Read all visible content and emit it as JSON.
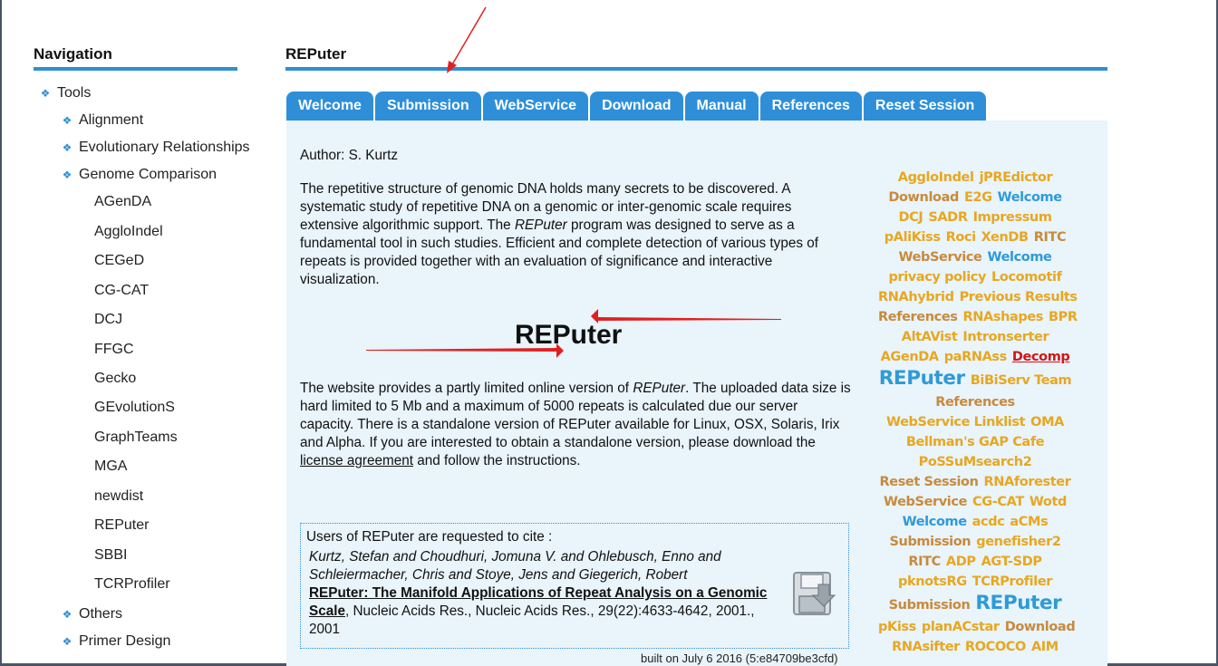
{
  "navigation": {
    "heading": "Navigation",
    "items": [
      {
        "label": "Tools",
        "level": 0,
        "expanded": true
      },
      {
        "label": "Alignment",
        "level": 1,
        "expanded": false
      },
      {
        "label": "Evolutionary Relationships",
        "level": 1,
        "expanded": false
      },
      {
        "label": "Genome Comparison",
        "level": 1,
        "expanded": true
      },
      {
        "label": "AGenDA",
        "level": 2
      },
      {
        "label": "AggloIndel",
        "level": 2
      },
      {
        "label": "CEGeD",
        "level": 2
      },
      {
        "label": "CG-CAT",
        "level": 2
      },
      {
        "label": "DCJ",
        "level": 2
      },
      {
        "label": "FFGC",
        "level": 2
      },
      {
        "label": "Gecko",
        "level": 2
      },
      {
        "label": "GEvolutionS",
        "level": 2
      },
      {
        "label": "GraphTeams",
        "level": 2
      },
      {
        "label": "MGA",
        "level": 2
      },
      {
        "label": "newdist",
        "level": 2
      },
      {
        "label": "REPuter",
        "level": 2
      },
      {
        "label": "SBBI",
        "level": 2
      },
      {
        "label": "TCRProfiler",
        "level": 2
      },
      {
        "label": "Others",
        "level": 1,
        "expanded": false
      },
      {
        "label": "Primer Design",
        "level": 1,
        "expanded": false
      }
    ]
  },
  "main": {
    "title": "REPuter",
    "tabs": [
      "Welcome",
      "Submission",
      "WebService",
      "Download",
      "Manual",
      "References",
      "Reset Session"
    ],
    "author": "Author: S. Kurtz",
    "desc1_a": "The repetitive structure of genomic DNA holds many secrets to be discovered. A systematic study of repetitive DNA on a genomic or inter-genomic scale requires extensive algorithmic support. The ",
    "desc1_em": "REPuter",
    "desc1_b": " program was designed to serve as a fundamental tool in such studies. Efficient and complete detection of various types of repeats is provided together with an evaluation of significance and interactive visualization.",
    "logo_text": "REPuter",
    "desc2_a": "The website provides a partly limited online version of ",
    "desc2_em": "REPuter",
    "desc2_b": ". The uploaded data size is hard limited to 5 Mb and a maximum of 5000 repeats is calculated due our server capacity. There is a standalone version of REPuter available for Linux, OSX, Solaris, Irix and Alpha. If you are interested to obtain a standalone version, please download the ",
    "desc2_link": "license agreement",
    "desc2_c": " and follow the instructions.",
    "cite": {
      "intro": "Users of REPuter are requested to cite :",
      "authors": "Kurtz, Stefan and Choudhuri, Jomuna V. and Ohlebusch, Enno and Schleiermacher, Chris and Stoye, Jens and Giegerich, Robert",
      "title": "REPuter: The Manifold Applications of Repeat Analysis on a Genomic Scale",
      "journal": ", Nucleic Acids Res., Nucleic Acids Res., 29(22):4633-4642, 2001., 2001"
    },
    "built": "built on July 6 2016 (5:e84709be3cfd)"
  },
  "tag_cloud": [
    [
      {
        "t": "AggloIndel",
        "c": "yellow",
        "s": 15
      },
      {
        "t": "jPREdictor",
        "c": "yellow",
        "s": 15
      }
    ],
    [
      {
        "t": "Download",
        "c": "brown",
        "s": 15
      },
      {
        "t": "E2G",
        "c": "yellow",
        "s": 15
      },
      {
        "t": "Welcome",
        "c": "blue",
        "s": 15
      }
    ],
    [
      {
        "t": "DCJ",
        "c": "yellow",
        "s": 15
      },
      {
        "t": "SADR",
        "c": "yellow",
        "s": 15
      },
      {
        "t": "Impressum",
        "c": "yellow",
        "s": 15
      }
    ],
    [
      {
        "t": "pAliKiss",
        "c": "yellow",
        "s": 15
      },
      {
        "t": "Roci",
        "c": "yellow",
        "s": 15
      },
      {
        "t": "XenDB",
        "c": "yellow",
        "s": 15
      },
      {
        "t": "RITC",
        "c": "brown",
        "s": 15
      }
    ],
    [
      {
        "t": "WebService",
        "c": "brown",
        "s": 15
      },
      {
        "t": "Welcome",
        "c": "blue",
        "s": 15
      }
    ],
    [
      {
        "t": "privacy policy",
        "c": "yellow",
        "s": 15
      },
      {
        "t": "Locomotif",
        "c": "yellow",
        "s": 15
      }
    ],
    [
      {
        "t": "RNAhybrid",
        "c": "yellow",
        "s": 15
      },
      {
        "t": "Previous Results",
        "c": "yellow",
        "s": 15
      }
    ],
    [
      {
        "t": "References",
        "c": "brown",
        "s": 15
      },
      {
        "t": "RNAshapes",
        "c": "yellow",
        "s": 15
      },
      {
        "t": "BPR",
        "c": "yellow",
        "s": 15
      }
    ],
    [
      {
        "t": "AltAVist",
        "c": "yellow",
        "s": 15
      },
      {
        "t": "Intronserter",
        "c": "yellow",
        "s": 15
      }
    ],
    [
      {
        "t": "AGenDA",
        "c": "yellow",
        "s": 15
      },
      {
        "t": "paRNAss",
        "c": "yellow",
        "s": 15
      },
      {
        "t": "Decomp",
        "c": "red",
        "s": 15
      }
    ],
    [
      {
        "t": "REPuter",
        "c": "blue",
        "s": 22
      },
      {
        "t": "BiBiServ Team",
        "c": "yellow",
        "s": 15
      }
    ],
    [
      {
        "t": "References",
        "c": "brown",
        "s": 15
      }
    ],
    [
      {
        "t": "WebService Linklist",
        "c": "yellow",
        "s": 15
      },
      {
        "t": "OMA",
        "c": "yellow",
        "s": 15
      }
    ],
    [
      {
        "t": "Bellman's GAP Cafe",
        "c": "yellow",
        "s": 15
      }
    ],
    [
      {
        "t": "PoSSuMsearch2",
        "c": "yellow",
        "s": 15
      }
    ],
    [
      {
        "t": "Reset Session",
        "c": "brown",
        "s": 15
      },
      {
        "t": "RNAforester",
        "c": "yellow",
        "s": 15
      }
    ],
    [
      {
        "t": "WebService",
        "c": "brown",
        "s": 15
      },
      {
        "t": "CG-CAT",
        "c": "yellow",
        "s": 15
      },
      {
        "t": "Wotd",
        "c": "yellow",
        "s": 15
      }
    ],
    [
      {
        "t": "Welcome",
        "c": "blue",
        "s": 15
      },
      {
        "t": "acdc",
        "c": "yellow",
        "s": 15
      },
      {
        "t": "aCMs",
        "c": "yellow",
        "s": 15
      }
    ],
    [
      {
        "t": "Submission",
        "c": "brown",
        "s": 15
      },
      {
        "t": "genefisher2",
        "c": "yellow",
        "s": 15
      }
    ],
    [
      {
        "t": "RITC",
        "c": "brown",
        "s": 15
      },
      {
        "t": "ADP",
        "c": "yellow",
        "s": 15
      },
      {
        "t": "AGT-SDP",
        "c": "yellow",
        "s": 15
      }
    ],
    [
      {
        "t": "pknotsRG",
        "c": "yellow",
        "s": 15
      },
      {
        "t": "TCRProfiler",
        "c": "yellow",
        "s": 15
      }
    ],
    [
      {
        "t": "Submission",
        "c": "brown",
        "s": 15
      },
      {
        "t": "REPuter",
        "c": "blue",
        "s": 22
      }
    ],
    [
      {
        "t": "pKiss",
        "c": "yellow",
        "s": 15
      },
      {
        "t": "planACstar",
        "c": "yellow",
        "s": 15
      },
      {
        "t": "Download",
        "c": "brown",
        "s": 15
      }
    ],
    [
      {
        "t": "RNAsifter",
        "c": "yellow",
        "s": 15
      },
      {
        "t": "ROCOCO",
        "c": "yellow",
        "s": 15
      },
      {
        "t": "AIM",
        "c": "yellow",
        "s": 15
      }
    ]
  ]
}
